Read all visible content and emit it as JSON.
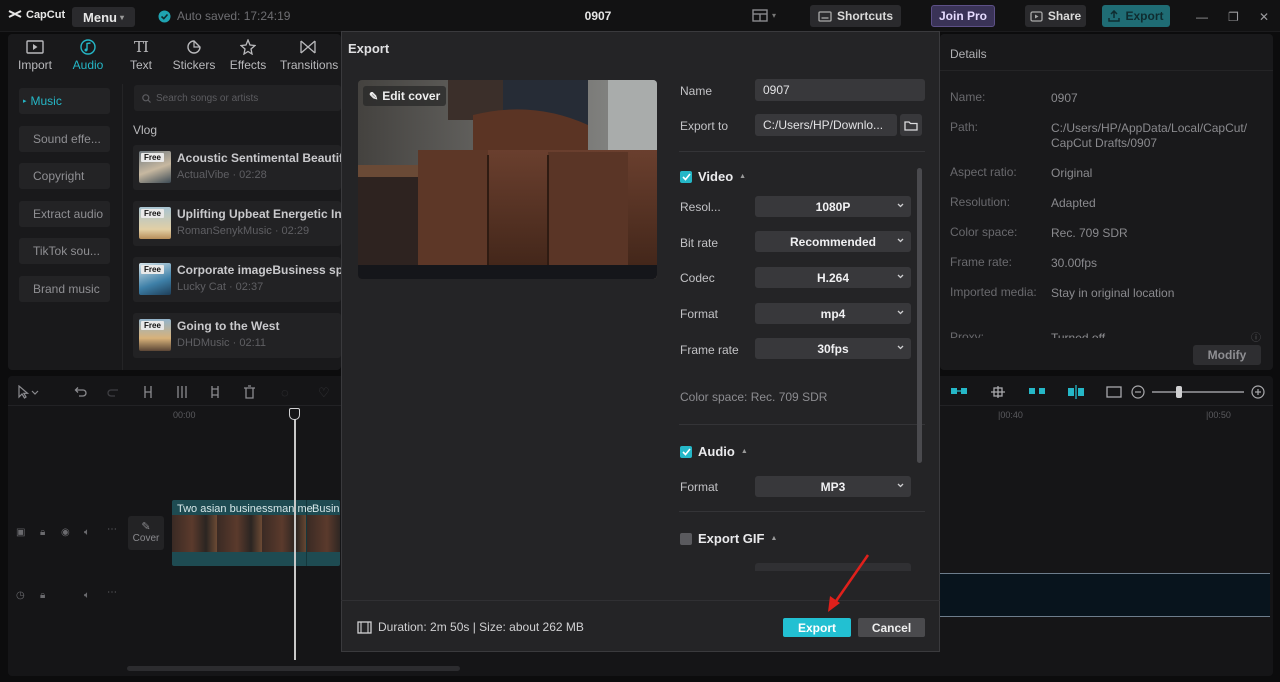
{
  "app": {
    "logo_text": "CapCut",
    "menu_label": "Menu",
    "autosave_text": "Auto saved: 17:24:19",
    "project_title": "0907",
    "shortcuts_label": "Shortcuts",
    "joinpro_label": "Join Pro",
    "share_label": "Share",
    "export_label": "Export"
  },
  "media_tabs": [
    {
      "label": "Import",
      "icon": "import-icon"
    },
    {
      "label": "Audio",
      "icon": "audio-icon"
    },
    {
      "label": "Text",
      "icon": "text-icon"
    },
    {
      "label": "Stickers",
      "icon": "stickers-icon"
    },
    {
      "label": "Effects",
      "icon": "effects-icon"
    },
    {
      "label": "Transitions",
      "icon": "transitions-icon"
    }
  ],
  "audio_sidebar": [
    "Music",
    "Sound effe...",
    "Copyright",
    "Extract audio",
    "TikTok sou...",
    "Brand music"
  ],
  "search_placeholder": "Search songs or artists",
  "category": "Vlog",
  "tracks": [
    {
      "badge": "Free",
      "title": "Acoustic Sentimental Beautiful",
      "meta": "ActualVibe · 02:28"
    },
    {
      "badge": "Free",
      "title": "Uplifting Upbeat Energetic Ins",
      "meta": "RomanSenykMusic · 02:29"
    },
    {
      "badge": "Free",
      "title": "Corporate imageBusiness sp",
      "meta": "Lucky Cat · 02:37"
    },
    {
      "badge": "Free",
      "title": "Going to the West",
      "meta": "DHDMusic · 02:11"
    }
  ],
  "details": {
    "heading": "Details",
    "rows": [
      {
        "k": "Name:",
        "v": "0907"
      },
      {
        "k": "Path:",
        "v": "C:/Users/HP/AppData/Local/CapCut/",
        "v2": "CapCut Drafts/0907"
      },
      {
        "k": "Aspect ratio:",
        "v": "Original"
      },
      {
        "k": "Resolution:",
        "v": "Adapted"
      },
      {
        "k": "Color space:",
        "v": "Rec. 709 SDR"
      },
      {
        "k": "Frame rate:",
        "v": "30.00fps"
      },
      {
        "k": "Imported media:",
        "v": "Stay in original location"
      },
      {
        "k": "Proxy:",
        "v": "Turned off"
      }
    ],
    "modify_label": "Modify"
  },
  "timeline": {
    "ruler_labels": [
      "00:00",
      "|00:40",
      "|00:50"
    ],
    "cover_label": "Cover",
    "clip1_label": "Two asian businessman me",
    "clip2_label": "Busin"
  },
  "export_dialog": {
    "title": "Export",
    "edit_cover_label": "Edit cover",
    "name_label": "Name",
    "name_value": "0907",
    "export_to_label": "Export to",
    "export_to_value": "C:/Users/HP/Downlo...",
    "video_section": "Video",
    "resolution_label": "Resol...",
    "resolution_value": "1080P",
    "bitrate_label": "Bit rate",
    "bitrate_value": "Recommended",
    "codec_label": "Codec",
    "codec_value": "H.264",
    "format_label": "Format",
    "format_value": "mp4",
    "framerate_label": "Frame rate",
    "framerate_value": "30fps",
    "colorspace_text": "Color space: Rec. 709 SDR",
    "audio_section": "Audio",
    "audio_format_label": "Format",
    "audio_format_value": "MP3",
    "gif_section": "Export GIF",
    "duration_text": "Duration: 2m 50s | Size: about 262 MB",
    "export_button": "Export",
    "cancel_button": "Cancel"
  },
  "colors": {
    "accent": "#25b7c7",
    "annotation_arrow": "#e0201b"
  }
}
